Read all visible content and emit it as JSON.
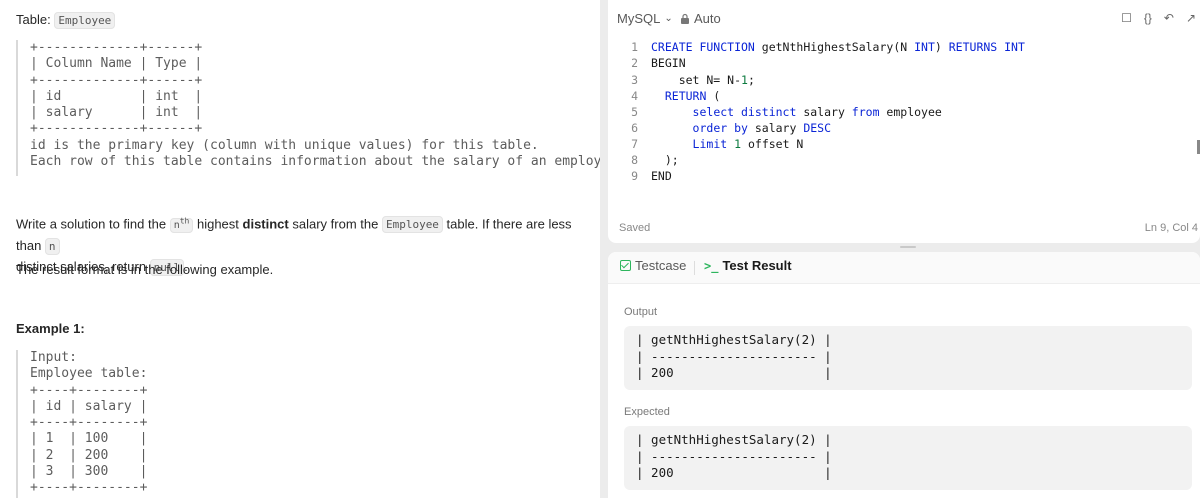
{
  "description": {
    "table_label": "Table:",
    "table_name": "Employee",
    "schema_text": "+-------------+------+\n| Column Name | Type |\n+-------------+------+\n| id          | int  |\n| salary      | int  |\n+-------------+------+\nid is the primary key (column with unique values) for this table.\nEach row of this table contains information about the salary of an employee.",
    "prompt_pre": "Write a solution to find the ",
    "prompt_n": "n",
    "prompt_th": "th",
    "prompt_mid": " highest ",
    "prompt_bold": "distinct",
    "prompt_post": " salary from the ",
    "prompt_table": "Employee",
    "prompt_post2": " table. If there are less than ",
    "prompt_n2": "n",
    "prompt_line2": "distinct salaries, return ",
    "prompt_null": "null",
    "prompt_end": ".",
    "result_format": "The result format is in the following example.",
    "example_title": "Example 1:",
    "example_text": "Input:\nEmployee table:\n+----+--------+\n| id | salary |\n+----+--------+\n| 1  | 100    |\n| 2  | 200    |\n| 3  | 300    |\n+----+--------+"
  },
  "editor": {
    "language": "MySQL",
    "mode": "Auto",
    "status": "Saved",
    "cursor": "Ln 9, Col 4",
    "lines": [
      {
        "n": "1",
        "text": "CREATE FUNCTION getNthHighestSalary(N INT) RETURNS INT"
      },
      {
        "n": "2",
        "text": "BEGIN"
      },
      {
        "n": "3",
        "text": "    set N= N-1;"
      },
      {
        "n": "4",
        "text": "  RETURN ("
      },
      {
        "n": "5",
        "text": "      select distinct salary from employee"
      },
      {
        "n": "6",
        "text": "      order by salary DESC"
      },
      {
        "n": "7",
        "text": "      Limit 1 offset N"
      },
      {
        "n": "8",
        "text": "  );"
      },
      {
        "n": "9",
        "text": "END"
      }
    ]
  },
  "result": {
    "tab_testcase": "Testcase",
    "tab_test_result": "Test Result",
    "output_label": "Output",
    "output_text": "| getNthHighestSalary(2) |\n| ---------------------- |\n| 200                    |",
    "expected_label": "Expected",
    "expected_text": "| getNthHighestSalary(2) |\n| ---------------------- |\n| 200                    |"
  }
}
